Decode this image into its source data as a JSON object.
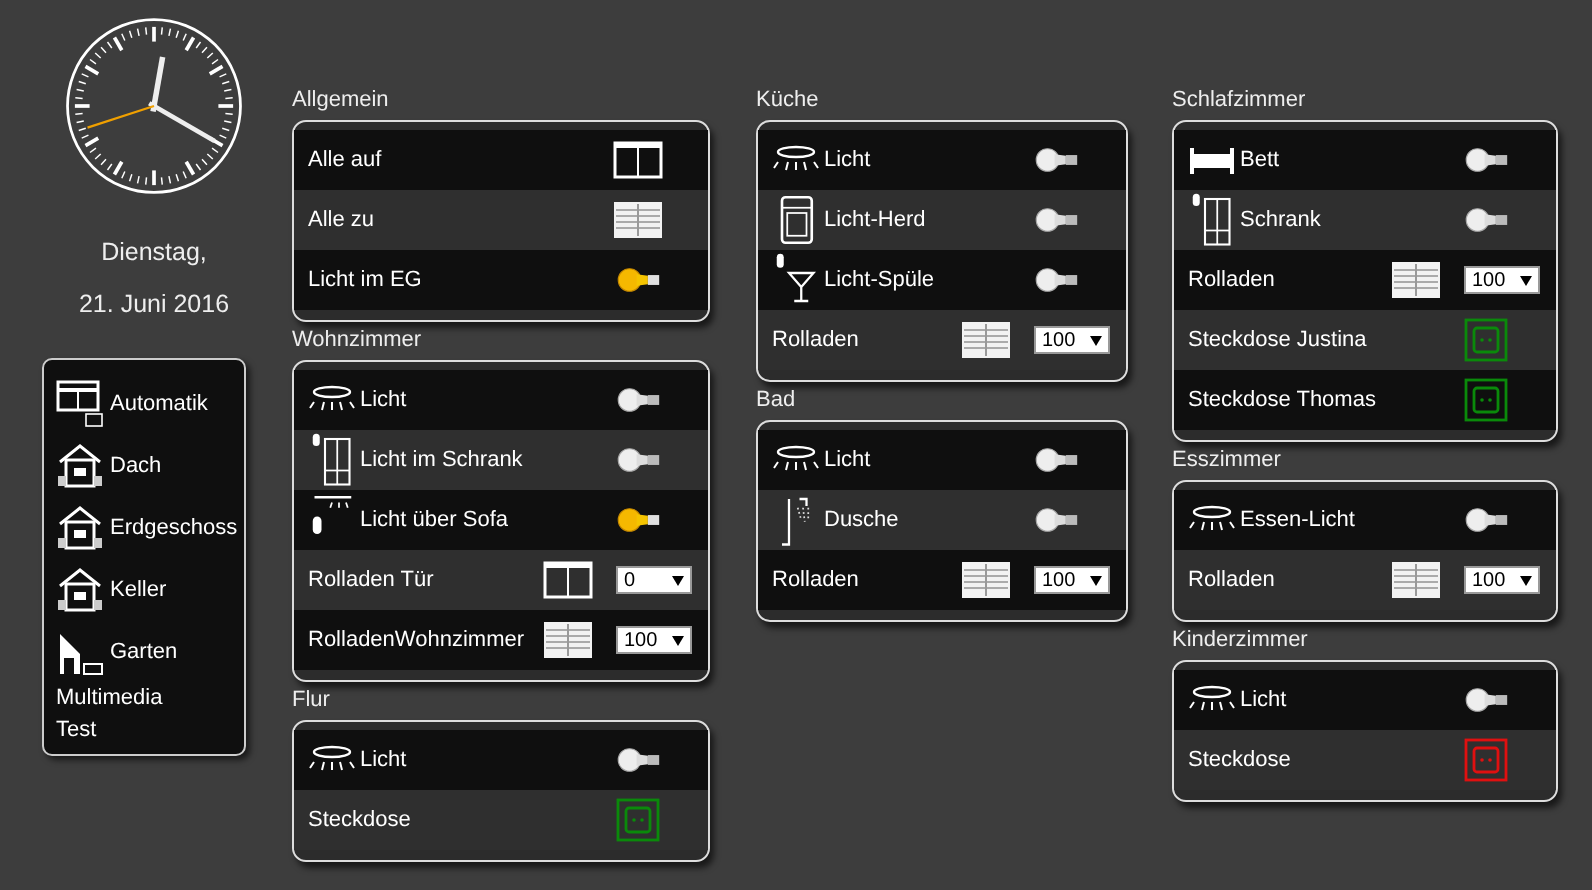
{
  "date": {
    "weekday": "Dienstag,",
    "day": "21. Juni 2016"
  },
  "nav": [
    {
      "label": "Automatik",
      "kind": "blinds"
    },
    {
      "label": "Dach",
      "kind": "house"
    },
    {
      "label": "Erdgeschoss",
      "kind": "house"
    },
    {
      "label": "Keller",
      "kind": "house"
    },
    {
      "label": "Garten",
      "kind": "garden"
    },
    {
      "label": "Multimedia",
      "kind": "text"
    },
    {
      "label": "Test",
      "kind": "text"
    }
  ],
  "columns": [
    [
      {
        "title": "Allgemein",
        "rows": [
          {
            "label": "Alle auf",
            "kind": "blind",
            "closed": false
          },
          {
            "label": "Alle zu",
            "kind": "blind",
            "closed": true
          },
          {
            "label": "Licht im EG",
            "kind": "light",
            "on": true
          }
        ]
      },
      {
        "title": "Wohnzimmer",
        "rows": [
          {
            "label": "Licht",
            "kind": "ceiling_light",
            "on": false
          },
          {
            "label": "Licht im Schrank",
            "kind": "cabinet_light",
            "on": false
          },
          {
            "label": "Licht über Sofa",
            "kind": "sofa_light",
            "on": true
          },
          {
            "label": "Rolladen Tür",
            "kind": "blind",
            "closed": false,
            "value": "0"
          },
          {
            "label": "RolladenWohnzimmer",
            "kind": "blind",
            "closed": true,
            "value": "100"
          }
        ]
      },
      {
        "title": "Flur",
        "rows": [
          {
            "label": "Licht",
            "kind": "ceiling_light",
            "on": false
          },
          {
            "label": "Steckdose",
            "kind": "socket",
            "on": true
          }
        ]
      }
    ],
    [
      {
        "title": "Küche",
        "rows": [
          {
            "label": "Licht",
            "kind": "ceiling_light",
            "on": false
          },
          {
            "label": "Licht-Herd",
            "kind": "oven_light",
            "on": false
          },
          {
            "label": "Licht-Spüle",
            "kind": "sink_light",
            "on": false
          },
          {
            "label": "Rolladen",
            "kind": "blind",
            "closed": true,
            "value": "100"
          }
        ]
      },
      {
        "title": "Bad",
        "rows": [
          {
            "label": "Licht",
            "kind": "ceiling_light",
            "on": false
          },
          {
            "label": "Dusche",
            "kind": "shower_light",
            "on": false
          },
          {
            "label": "Rolladen",
            "kind": "blind",
            "closed": true,
            "value": "100"
          }
        ]
      }
    ],
    [
      {
        "title": "Schlafzimmer",
        "rows": [
          {
            "label": "Bett",
            "kind": "bed_light",
            "on": false
          },
          {
            "label": "Schrank",
            "kind": "cabinet_light",
            "on": false
          },
          {
            "label": "Rolladen",
            "kind": "blind",
            "closed": true,
            "value": "100"
          },
          {
            "label": "Steckdose Justina",
            "kind": "socket",
            "on": true
          },
          {
            "label": "Steckdose Thomas",
            "kind": "socket",
            "on": true
          }
        ]
      },
      {
        "title": "Esszimmer",
        "rows": [
          {
            "label": "Essen-Licht",
            "kind": "ceiling_light",
            "on": false
          },
          {
            "label": "Rolladen",
            "kind": "blind",
            "closed": true,
            "value": "100"
          }
        ]
      },
      {
        "title": "Kinderzimmer",
        "rows": [
          {
            "label": "Licht",
            "kind": "ceiling_light",
            "on": false
          },
          {
            "label": "Steckdose",
            "kind": "socket",
            "on": false
          }
        ]
      }
    ]
  ]
}
